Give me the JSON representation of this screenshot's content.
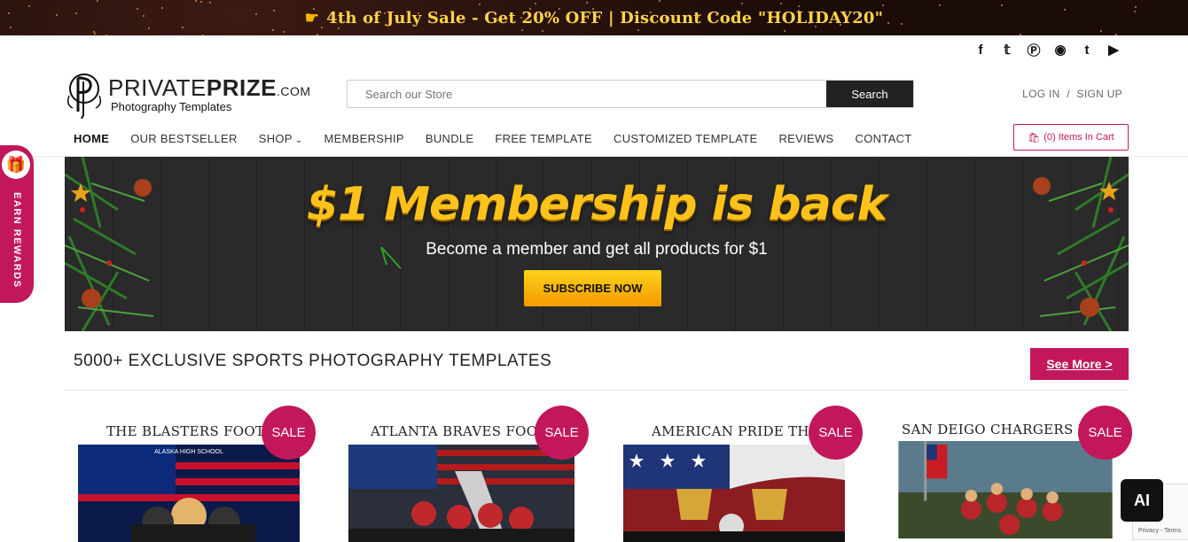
{
  "promo_bar": {
    "icon": "pointing-hand-icon",
    "text": "4th of July Sale - Get 20% OFF | Discount Code \"HOLIDAY20\""
  },
  "social": [
    "facebook-icon",
    "twitter-icon",
    "pinterest-icon",
    "instagram-icon",
    "tumblr-icon",
    "youtube-icon"
  ],
  "logo": {
    "name_light": "PRIVATE",
    "name_bold": "PRIZE",
    "name_suffix": ".COM",
    "tagline": "Photography Templates"
  },
  "search": {
    "placeholder": "Search our Store",
    "button": "Search"
  },
  "auth": {
    "login": "LOG IN",
    "separator": "/",
    "signup": "SIGN UP"
  },
  "nav": {
    "items": [
      "HOME",
      "OUR BESTSELLER",
      "SHOP",
      "MEMBERSHIP",
      "BUNDLE",
      "FREE TEMPLATE",
      "CUSTOMIZED TEMPLATE",
      "REVIEWS",
      "CONTACT"
    ],
    "active": "HOME"
  },
  "cart": {
    "label": "(0) Items In Cart"
  },
  "rewards": {
    "label": "EARN REWARDS"
  },
  "banner": {
    "title": "$1 Membership is back",
    "subtitle": "Become a member and get all products for $1",
    "button": "SUBSCRIBE NOW"
  },
  "section": {
    "title": "5000+ EXCLUSIVE SPORTS PHOTOGRAPHY TEMPLATES",
    "see_more": "See More >"
  },
  "products": [
    {
      "title": "THE BLASTERS FOOTBALL",
      "badge": "SALE",
      "img_caption": "ALASKA HIGH SCHOOL"
    },
    {
      "title": "ATLANTA BRAVES FOOTBALL",
      "badge": "SALE"
    },
    {
      "title": "AMERICAN PRIDE THEME",
      "badge": "SALE"
    },
    {
      "title": "SAN DEIGO CHARGERS FOOTBALL",
      "badge": "SALE"
    }
  ],
  "ai_badge": "AI",
  "recaptcha": {
    "label": "Privacy - Terms"
  },
  "colors": {
    "accent": "#c2185b",
    "banner_gold": "#ffc21a",
    "dark": "#222222"
  }
}
